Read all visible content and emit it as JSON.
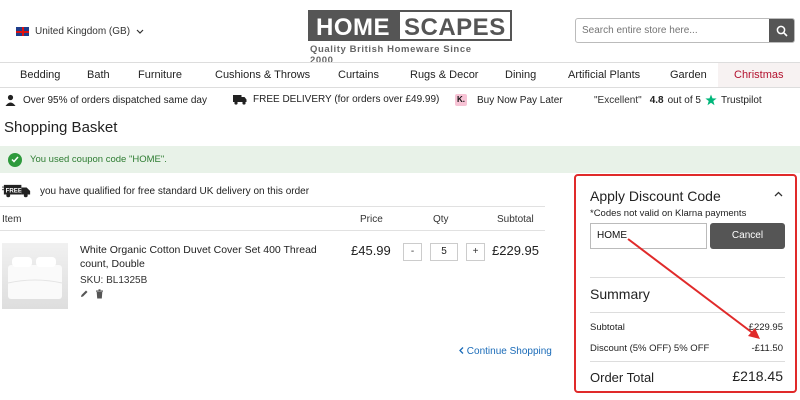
{
  "header": {
    "region": "United Kingdom (GB)",
    "logo_home": "HOME",
    "logo_scapes": "SCAPES",
    "logo_tagline": "Quality British Homeware Since 2000",
    "search_placeholder": "Search entire store here..."
  },
  "nav": {
    "items": [
      "Bedding",
      "Bath",
      "Furniture",
      "Cushions & Throws",
      "Curtains",
      "Rugs & Decor",
      "Dining",
      "Artificial Plants",
      "Garden",
      "Christmas"
    ]
  },
  "usp": {
    "dispatch": "Over 95% of orders dispatched same day",
    "delivery": "FREE DELIVERY (for orders over £49.99)",
    "klarna_glyph": "K.",
    "paylater": "Buy Now Pay Later",
    "rating_text": "\"Excellent\"",
    "rating_score": "4.8",
    "rating_outof": "out of 5",
    "trustpilot": "Trustpilot"
  },
  "page": {
    "title": "Shopping Basket",
    "coupon_message": "You used coupon code \"HOME\".",
    "free_delivery_msg": "you have qualified for free standard UK delivery on this order",
    "free_badge": "FREE"
  },
  "table": {
    "headers": [
      "Item",
      "Price",
      "Qty",
      "Subtotal"
    ],
    "rows": [
      {
        "name": "White Organic Cotton Duvet Cover Set 400 Thread count, Double",
        "sku": "SKU: BL1325B",
        "price": "£45.99",
        "qty": "5",
        "subtotal": "£229.95"
      }
    ],
    "qty_minus": "-",
    "qty_plus": "+"
  },
  "continue_label": "Continue Shopping",
  "panel": {
    "title": "Apply Discount Code",
    "note": "*Codes not valid on Klarna payments",
    "coupon_value": "HOME",
    "cancel_label": "Cancel",
    "summary_title": "Summary",
    "subtotal_label": "Subtotal",
    "subtotal_value": "£229.95",
    "discount_label": "Discount (5% OFF) 5% OFF",
    "discount_value": "-£11.50",
    "total_label": "Order Total",
    "total_value": "£218.45"
  },
  "colors": {
    "accent_red": "#e02a2a",
    "success_green": "#2e7d32",
    "link_blue": "#1a6bb8",
    "christmas": "#b3122f"
  }
}
